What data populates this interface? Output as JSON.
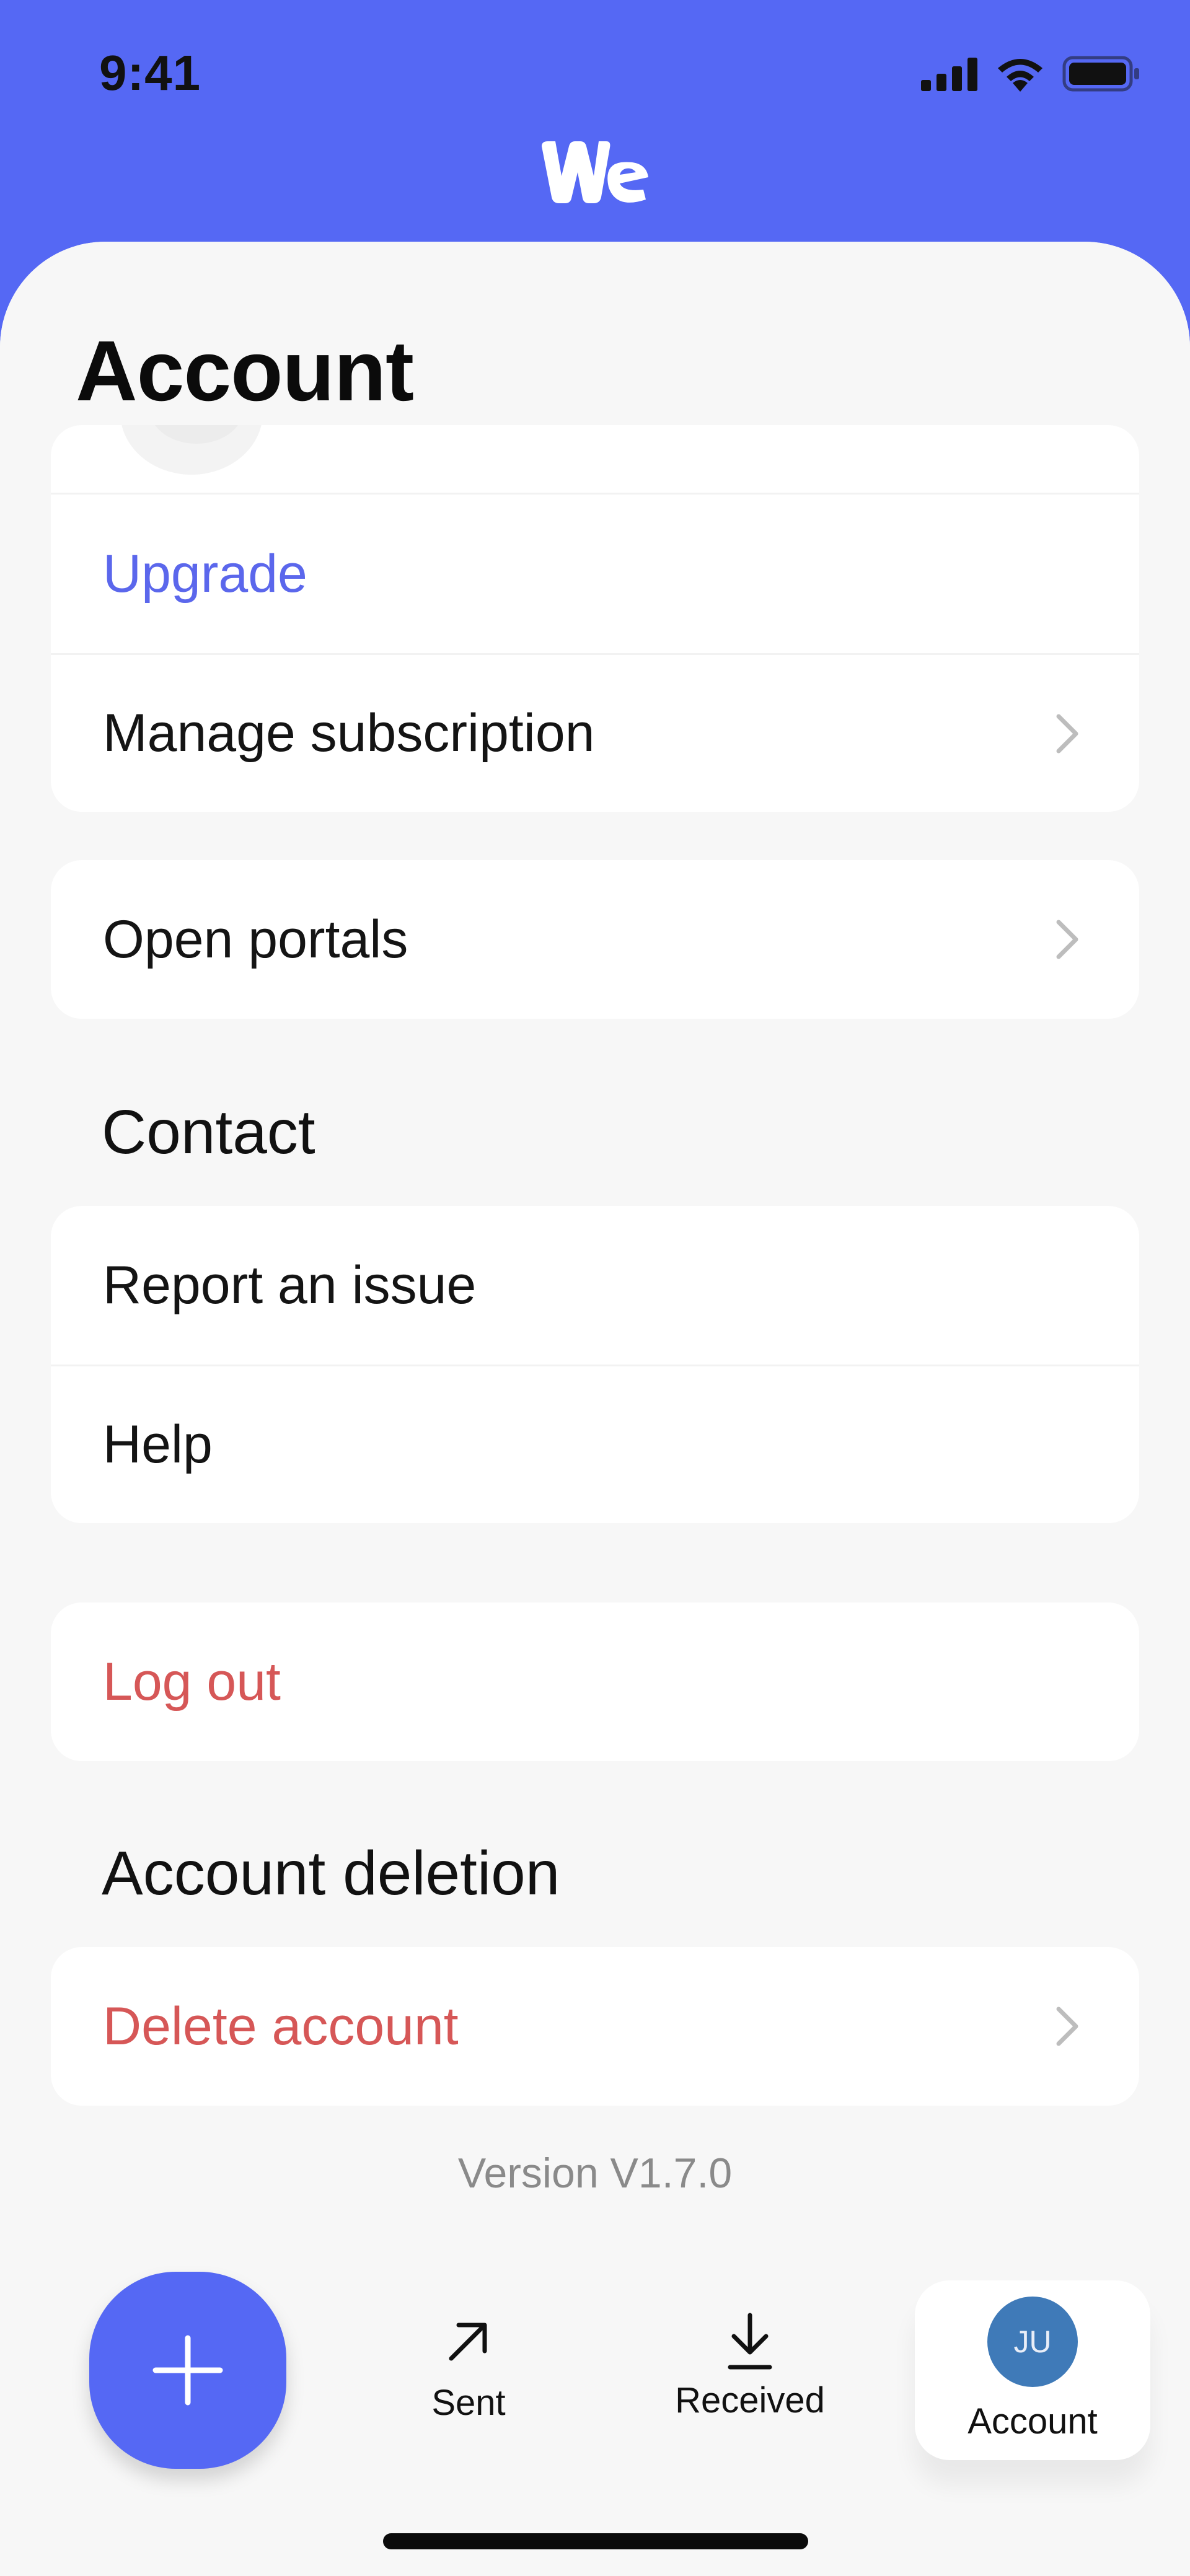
{
  "status_bar": {
    "time": "9:41"
  },
  "header": {
    "logo_icon": "wetransfer-logo"
  },
  "page": {
    "title": "Account"
  },
  "card_subscription": {
    "upgrade_label": "Upgrade",
    "manage_label": "Manage subscription"
  },
  "card_portals": {
    "open_portals_label": "Open portals"
  },
  "contact": {
    "title": "Contact",
    "report_label": "Report an issue",
    "help_label": "Help"
  },
  "logout": {
    "label": "Log out"
  },
  "deletion": {
    "title": "Account deletion",
    "delete_label": "Delete account"
  },
  "footer": {
    "version": "Version V1.7.0"
  },
  "tab_bar": {
    "add_icon": "plus-icon",
    "sent_label": "Sent",
    "received_label": "Received",
    "account_label": "Account",
    "avatar_initials": "JU"
  },
  "colors": {
    "accent": "#5568f4",
    "link": "#5b67ec",
    "danger": "#d65757",
    "avatar": "#3f7ab8"
  }
}
